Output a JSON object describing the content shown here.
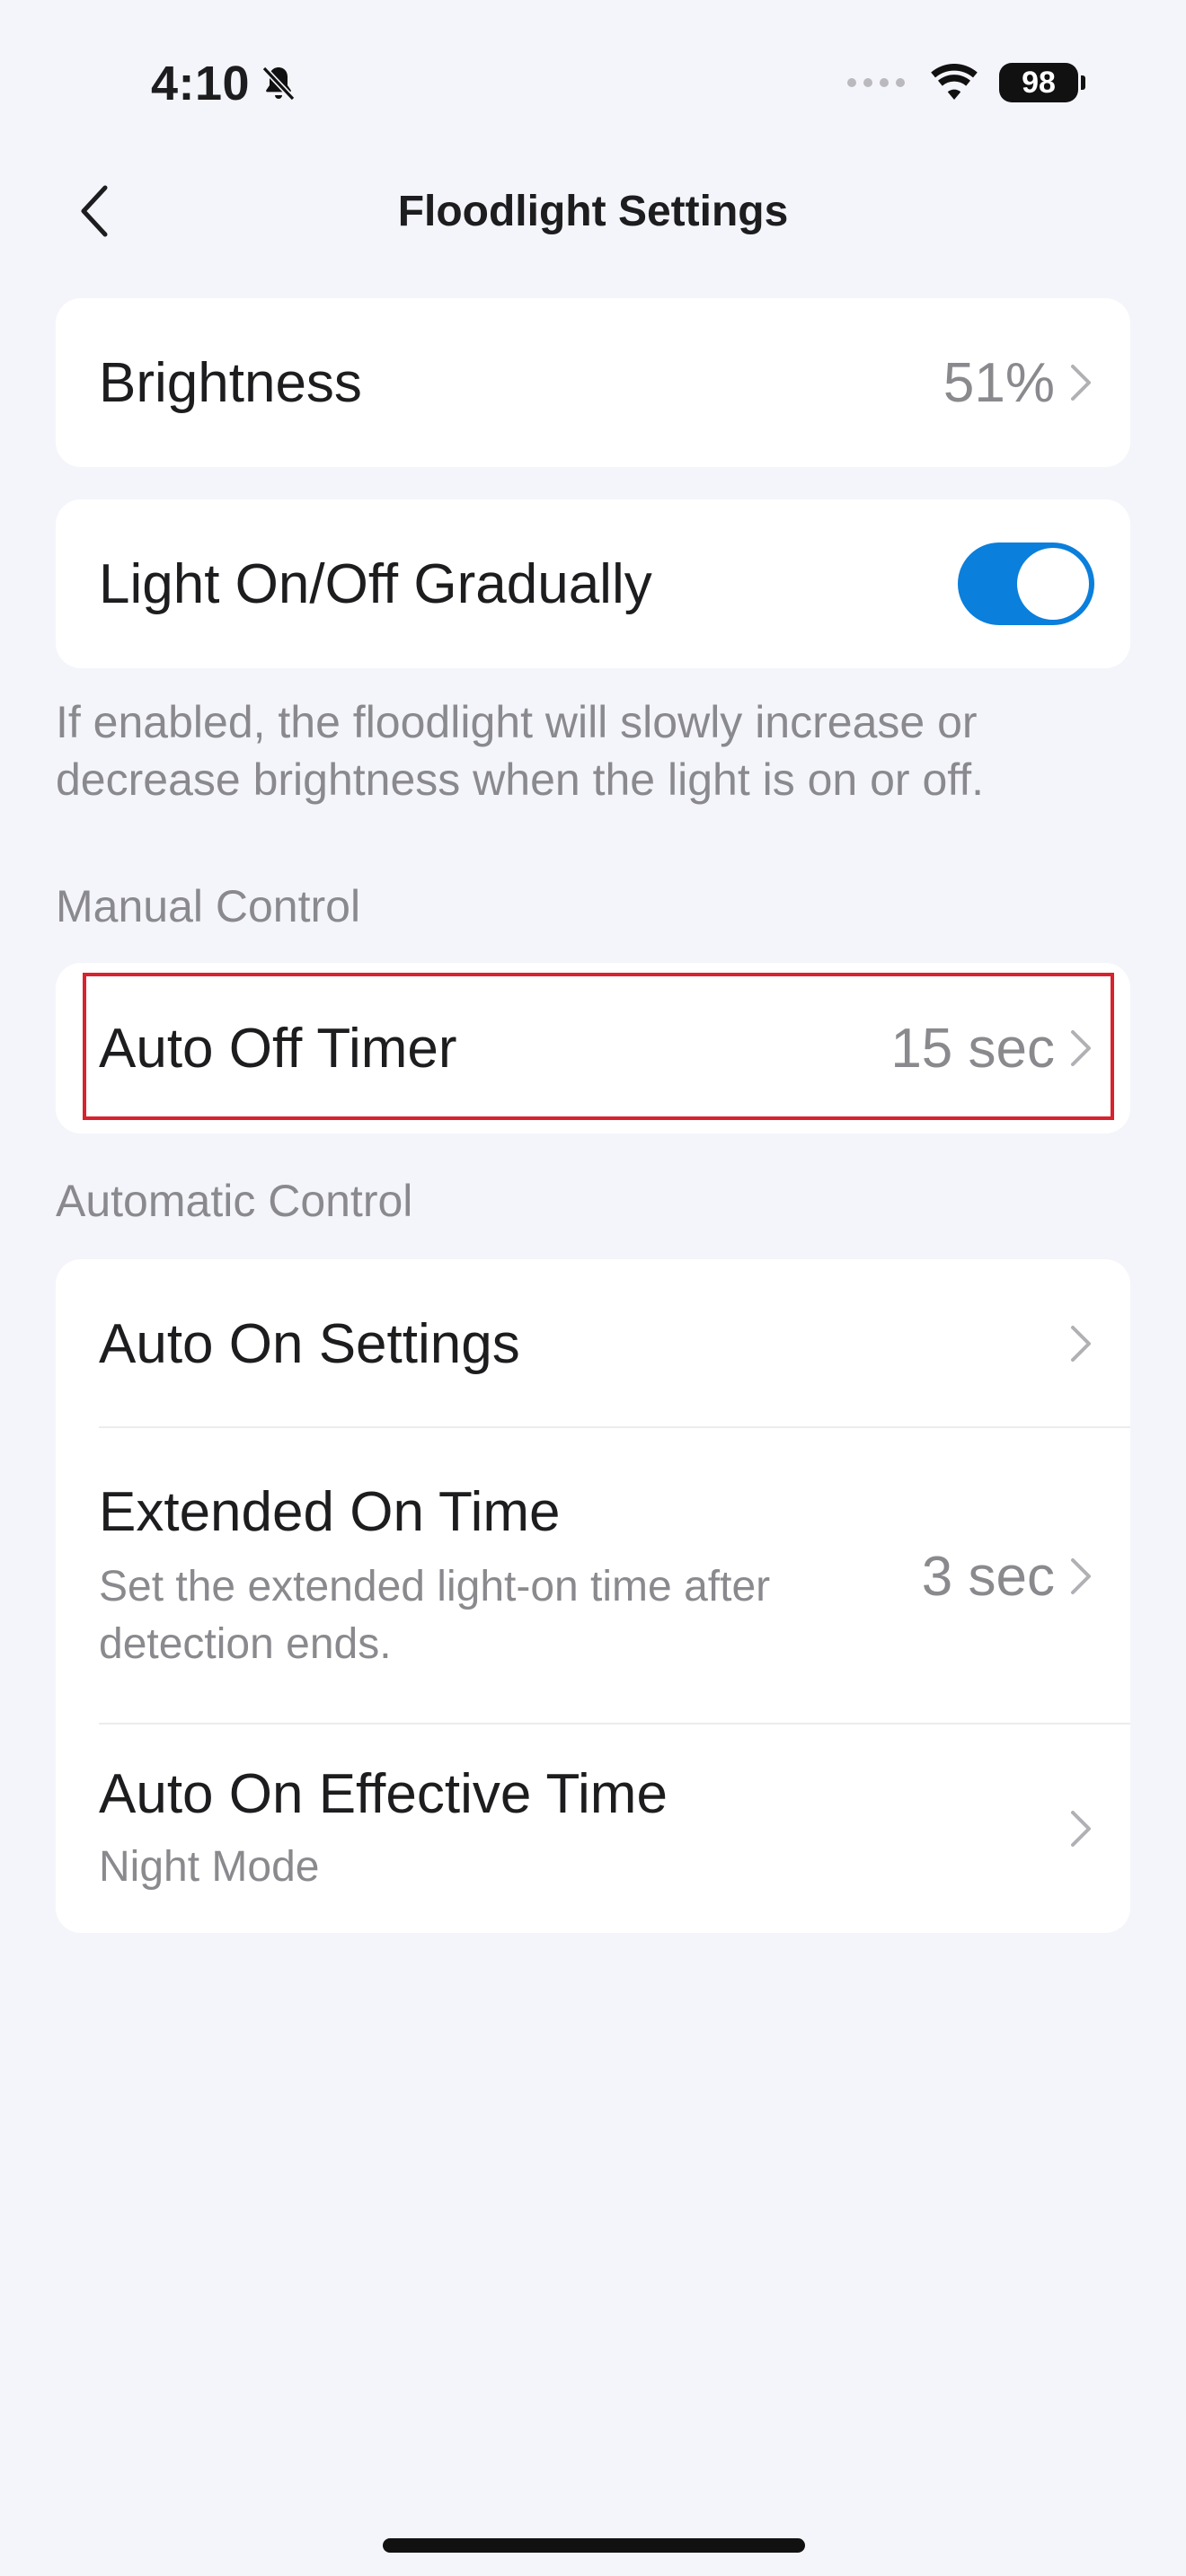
{
  "status_bar": {
    "time": "4:10",
    "battery": "98"
  },
  "nav": {
    "title": "Floodlight Settings"
  },
  "brightness": {
    "label": "Brightness",
    "value": "51%"
  },
  "gradual": {
    "label": "Light On/Off Gradually",
    "enabled": true,
    "description": "If enabled, the floodlight will slowly increase or decrease brightness when the light is on or off."
  },
  "manual": {
    "header": "Manual Control",
    "auto_off": {
      "label": "Auto Off Timer",
      "value": "15 sec"
    }
  },
  "automatic": {
    "header": "Automatic Control",
    "auto_on": {
      "label": "Auto On Settings"
    },
    "extended": {
      "label": "Extended On Time",
      "sub": "Set the extended light-on time after detection ends.",
      "value": "3 sec"
    },
    "effective": {
      "label": "Auto On Effective Time",
      "sub": "Night Mode"
    }
  },
  "colors": {
    "accent": "#0a7fdc",
    "highlight": "#d8222e",
    "background": "#f4f5fa"
  }
}
